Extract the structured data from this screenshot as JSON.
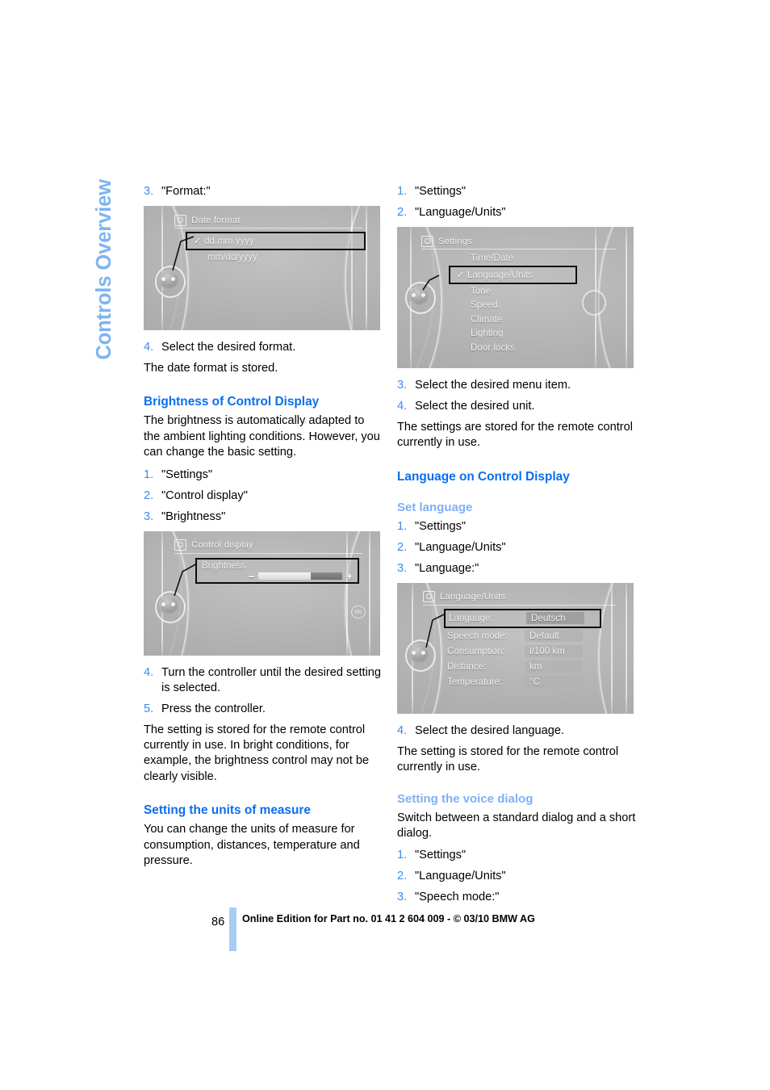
{
  "chapter_tab": "Controls Overview",
  "left_column": {
    "step_format": {
      "num": "3.",
      "text": "\"Format:\""
    },
    "figure_date_format": {
      "title": "Date format",
      "title_icon": "display-settings-icon",
      "items": [
        {
          "label": "dd.mm.yyyy",
          "selected": true,
          "checked": true
        },
        {
          "label": "mm/dd/yyyy",
          "selected": false,
          "checked": false
        }
      ]
    },
    "step_select_format": {
      "num": "4.",
      "text": "Select the desired format."
    },
    "para_date_stored": "The date format is stored.",
    "heading_brightness": "Brightness of Control Display",
    "para_brightness": "The brightness is automatically adapted to the ambient lighting conditions. However, you can change the basic setting.",
    "brightness_steps": [
      {
        "num": "1.",
        "text": "\"Settings\""
      },
      {
        "num": "2.",
        "text": "\"Control display\""
      },
      {
        "num": "3.",
        "text": "\"Brightness\""
      }
    ],
    "figure_control_display": {
      "title": "Control display",
      "title_icon": "display-settings-icon",
      "slider_label": "Brightness",
      "minus": "–",
      "plus": "+",
      "fill_percent": 62
    },
    "brightness_steps2": [
      {
        "num": "4.",
        "text": "Turn the controller until the desired setting is selected."
      },
      {
        "num": "5.",
        "text": "Press the controller."
      }
    ],
    "para_brightness_stored": "The setting is stored for the remote control currently in use. In bright conditions, for example, the brightness control may not be clearly visible.",
    "heading_units": "Setting the units of measure",
    "para_units": "You can change the units of measure for consumption, distances, temperature and pressure."
  },
  "right_column": {
    "units_steps": [
      {
        "num": "1.",
        "text": "\"Settings\""
      },
      {
        "num": "2.",
        "text": "\"Language/Units\""
      }
    ],
    "figure_settings": {
      "title": "Settings",
      "title_icon": "display-settings-icon",
      "items": [
        {
          "label": "Time/Date",
          "selected": false,
          "checked": false
        },
        {
          "label": "Language/Units",
          "selected": true,
          "checked": true
        },
        {
          "label": "Tone",
          "selected": false,
          "checked": false
        },
        {
          "label": "Speed",
          "selected": false,
          "checked": false
        },
        {
          "label": "Climate",
          "selected": false,
          "checked": false
        },
        {
          "label": "Lighting",
          "selected": false,
          "checked": false
        },
        {
          "label": "Door locks",
          "selected": false,
          "checked": false
        }
      ]
    },
    "units_steps2": [
      {
        "num": "3.",
        "text": "Select the desired menu item."
      },
      {
        "num": "4.",
        "text": "Select the desired unit."
      }
    ],
    "para_units_stored": "The settings are stored for the remote control currently in use.",
    "heading_language": "Language on Control Display",
    "subheading_set_language": "Set language",
    "language_steps": [
      {
        "num": "1.",
        "text": "\"Settings\""
      },
      {
        "num": "2.",
        "text": "\"Language/Units\""
      },
      {
        "num": "3.",
        "text": "\"Language:\""
      }
    ],
    "figure_language_units": {
      "title": "Language/Units",
      "title_icon": "display-settings-icon",
      "rows": [
        {
          "key": "Language:",
          "value": "Deutsch",
          "selected": true
        },
        {
          "key": "Speech mode:",
          "value": "Default",
          "selected": false
        },
        {
          "key": "Consumption:",
          "value": "l/100 km",
          "selected": false
        },
        {
          "key": "Distance:",
          "value": "km",
          "selected": false
        },
        {
          "key": "Temperature:",
          "value": "°C",
          "selected": false
        }
      ]
    },
    "step_select_language": {
      "num": "4.",
      "text": "Select the desired language."
    },
    "para_language_stored": "The setting is stored for the remote control currently in use.",
    "subheading_voice_dialog": "Setting the voice dialog",
    "para_voice_dialog": "Switch between a standard dialog and a short dialog.",
    "voice_steps": [
      {
        "num": "1.",
        "text": "\"Settings\""
      },
      {
        "num": "2.",
        "text": "\"Language/Units\""
      },
      {
        "num": "3.",
        "text": "\"Speech mode:\""
      }
    ]
  },
  "footer": {
    "page_number": "86",
    "text": "Online Edition for Part no. 01 41 2 604 009 - © 03/10 BMW AG"
  },
  "colors": {
    "heading_blue": "#0a6ef0",
    "subheading_blue": "#7eb0f5",
    "step_number_blue": "#3b8cf0",
    "chapter_tab_blue": "#7eb4f3",
    "footer_bar_blue": "#a8cdf5"
  }
}
